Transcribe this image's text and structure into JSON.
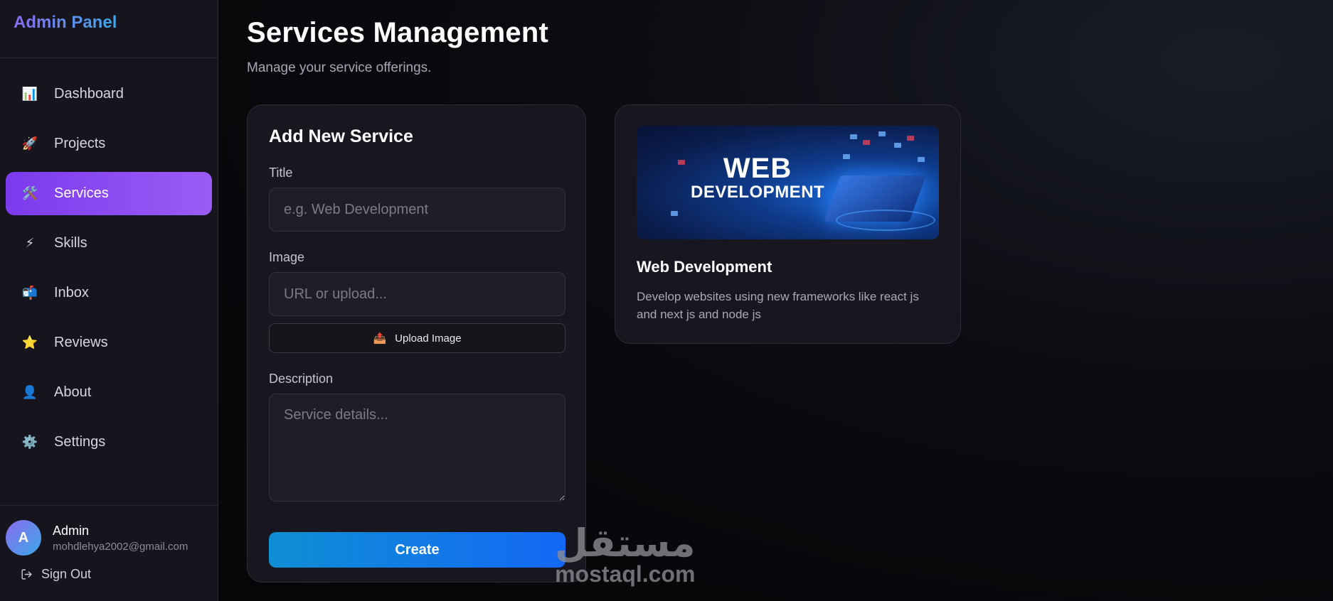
{
  "sidebar": {
    "brand": "Admin Panel",
    "items": [
      {
        "label": "Dashboard",
        "icon": "📊"
      },
      {
        "label": "Projects",
        "icon": "🚀"
      },
      {
        "label": "Services",
        "icon": "🛠️"
      },
      {
        "label": "Skills",
        "icon": "⚡"
      },
      {
        "label": "Inbox",
        "icon": "📬"
      },
      {
        "label": "Reviews",
        "icon": "⭐"
      },
      {
        "label": "About",
        "icon": "👤"
      },
      {
        "label": "Settings",
        "icon": "⚙️"
      }
    ],
    "active": "Services",
    "user": {
      "initial": "A",
      "name": "Admin",
      "email": "mohdlehya2002@gmail.com"
    },
    "signout_label": "Sign Out"
  },
  "main": {
    "title": "Services Management",
    "subtitle": "Manage your service offerings.",
    "form": {
      "heading": "Add New Service",
      "title_label": "Title",
      "title_placeholder": "e.g. Web Development",
      "image_label": "Image",
      "image_placeholder": "URL or upload...",
      "upload_label": "Upload Image",
      "description_label": "Description",
      "description_placeholder": "Service details...",
      "create_label": "Create"
    },
    "services": [
      {
        "image_text_line1": "WEB",
        "image_text_line2": "DEVELOPMENT",
        "title": "Web Development",
        "description": "Develop websites using new frameworks like react js and next js and node js"
      }
    ]
  },
  "watermark": {
    "arabic": "مستقل",
    "latin": "mostaql.com"
  },
  "colors": {
    "accent": "#7c3aed",
    "create_button": "#1468f5",
    "background": "#09090c"
  }
}
